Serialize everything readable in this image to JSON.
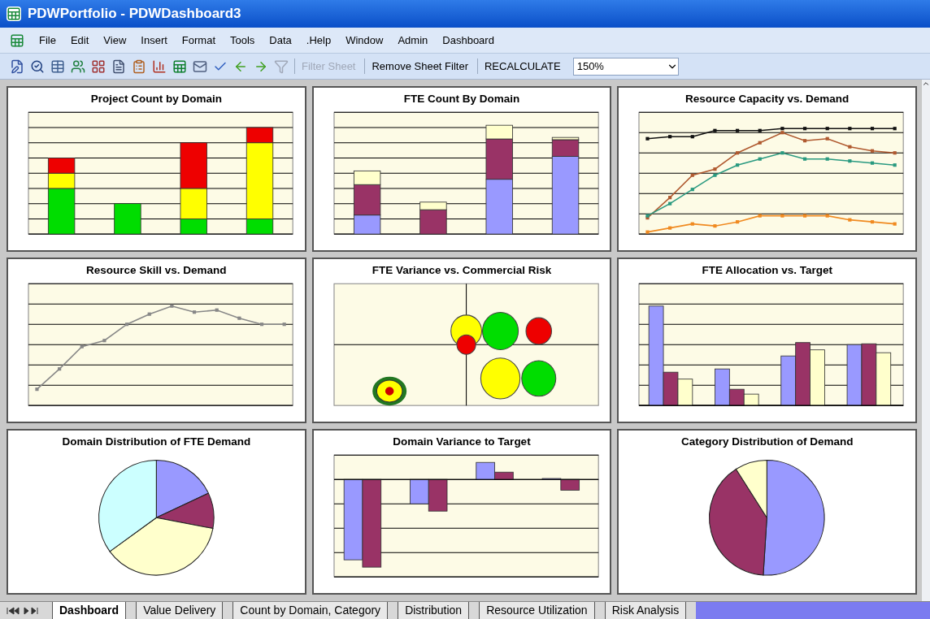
{
  "window": {
    "title": "PDWPortfolio - PDWDashboard3"
  },
  "menu": [
    "File",
    "Edit",
    "View",
    "Insert",
    "Format",
    "Tools",
    "Data",
    ".Help",
    "Window",
    "Admin",
    "Dashboard"
  ],
  "toolbar": {
    "buttons": [
      {
        "label": "Filter Sheet",
        "disabled": true
      },
      {
        "label": "Remove Sheet Filter",
        "disabled": false
      },
      {
        "label": "RECALCULATE",
        "disabled": false
      }
    ],
    "zoom": "150%"
  },
  "charts": [
    {
      "title": "Project Count by Domain",
      "kind": "stacked-status"
    },
    {
      "title": "FTE Count By Domain",
      "kind": "stacked-fte"
    },
    {
      "title": "Resource Capacity vs. Demand",
      "kind": "multi-line"
    },
    {
      "title": "Resource Skill vs. Demand",
      "kind": "line"
    },
    {
      "title": "FTE Variance vs. Commercial Risk",
      "kind": "bubble"
    },
    {
      "title": "FTE Allocation vs. Target",
      "kind": "grouped-bar"
    },
    {
      "title": "Domain Distribution of FTE Demand",
      "kind": "pie-domain"
    },
    {
      "title": "Domain Variance to Target",
      "kind": "variance-bar"
    },
    {
      "title": "Category Distribution of Demand",
      "kind": "pie-category"
    }
  ],
  "sheet_tabs": [
    {
      "label": "Dashboard",
      "selected": true
    },
    {
      "label": "Value Delivery",
      "selected": false
    },
    {
      "label": "Count by Domain, Category",
      "selected": false
    },
    {
      "label": "Distribution",
      "selected": false
    },
    {
      "label": "Resource Utilization",
      "selected": false
    },
    {
      "label": "Risk Analysis",
      "selected": false
    }
  ]
}
